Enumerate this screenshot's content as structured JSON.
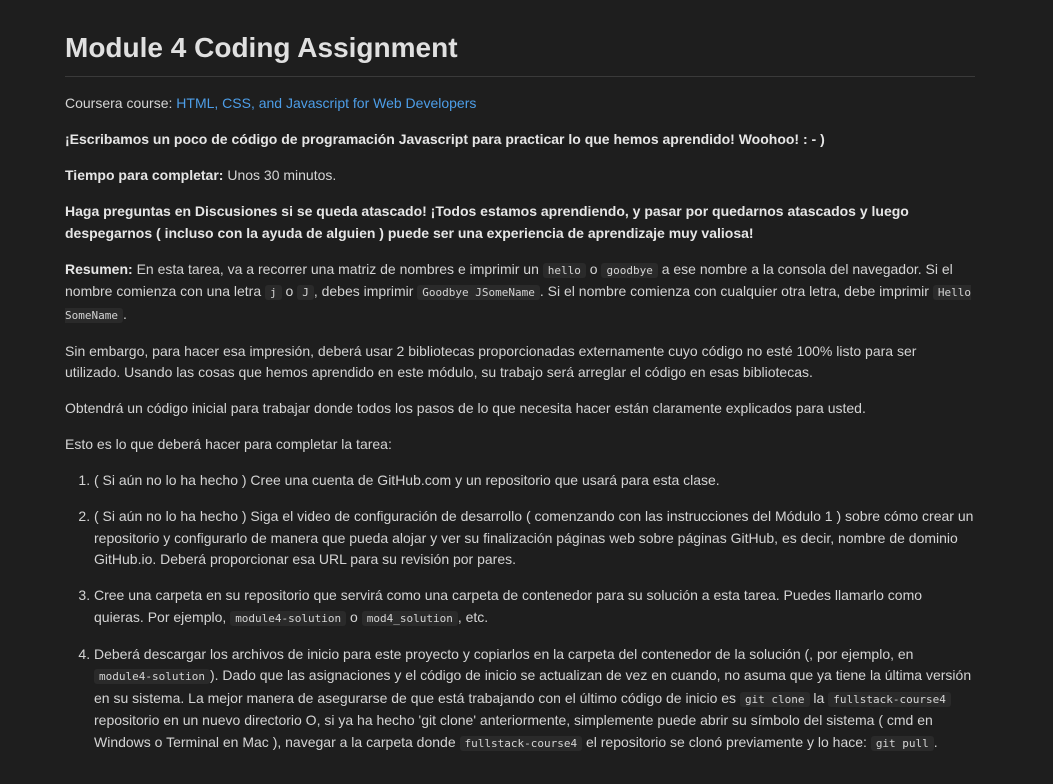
{
  "title": "Module 4 Coding Assignment",
  "course": {
    "label": "Coursera course: ",
    "link_text": "HTML, CSS, and Javascript for Web Developers"
  },
  "intro": "¡Escribamos un poco de código de programación Javascript para practicar lo que hemos aprendido! Woohoo! : - )",
  "time": {
    "label": "Tiempo para completar:",
    "value": " Unos 30 minutos."
  },
  "help": "Haga preguntas en Discusiones si se queda atascado! ¡Todos estamos aprendiendo, y pasar por quedarnos atascados y luego despegarnos ( incluso con la ayuda de alguien ) puede ser una experiencia de aprendizaje muy valiosa!",
  "summary": {
    "label": "Resumen:",
    "t1": " En esta tarea, va a recorrer una matriz de nombres e imprimir un ",
    "c1": "hello",
    "t2": " o ",
    "c2": "goodbye",
    "t3": " a ese nombre a la consola del navegador. Si el nombre comienza con una letra ",
    "c3": "j",
    "t4": " o ",
    "c4": "J",
    "t5": ", debes imprimir ",
    "c5": "Goodbye JSomeName",
    "t6": ". Si el nombre comienza con cualquier otra letra, debe imprimir ",
    "c6": "Hello SomeName",
    "t7": "."
  },
  "para_libs": "Sin embargo, para hacer esa impresión, deberá usar 2 bibliotecas proporcionadas externamente cuyo código no esté 100% listo para ser utilizado. Usando las cosas que hemos aprendido en este módulo, su trabajo será arreglar el código en esas bibliotecas.",
  "para_start": "Obtendrá un código inicial para trabajar donde todos los pasos de lo que necesita hacer están claramente explicados para usted.",
  "para_todo": "Esto es lo que deberá hacer para completar la tarea:",
  "steps": {
    "s1": "( Si aún no lo ha hecho ) Cree una cuenta de GitHub.com y un repositorio que usará para esta clase.",
    "s2": "( Si aún no lo ha hecho ) Siga el video de configuración de desarrollo ( comenzando con las instrucciones del Módulo 1 ) sobre cómo crear un repositorio y configurarlo de manera que pueda alojar y ver su finalización páginas web sobre páginas GitHub, es decir, nombre de dominio GitHub.io. Deberá proporcionar esa URL para su revisión por pares.",
    "s3": {
      "t1": "Cree una carpeta en su repositorio que servirá como una carpeta de contenedor para su solución a esta tarea. Puedes llamarlo como quieras. Por ejemplo, ",
      "c1": "module4-solution",
      "t2": " o ",
      "c2": "mod4_solution",
      "t3": ", etc."
    },
    "s4": {
      "t1": "Deberá descargar los archivos de inicio para este proyecto y copiarlos en la carpeta del contenedor de la solución (, por ejemplo, en ",
      "c1": "module4-solution",
      "t2": "). Dado que las asignaciones y el código de inicio se actualizan de vez en cuando, no asuma que ya tiene la última versión en su sistema. La mejor manera de asegurarse de que está trabajando con el último código de inicio es ",
      "c2": "git clone",
      "t3": " la ",
      "c3": "fullstack-course4",
      "t4": " repositorio en un nuevo directorio O, si ya ha hecho 'git clone' anteriormente, simplemente puede abrir su símbolo del sistema ( cmd en Windows o Terminal en Mac ), navegar a la carpeta donde ",
      "c4": "fullstack-course4",
      "t5": " el repositorio se clonó previamente y lo hace: ",
      "c5": "git pull",
      "t6": "."
    }
  }
}
